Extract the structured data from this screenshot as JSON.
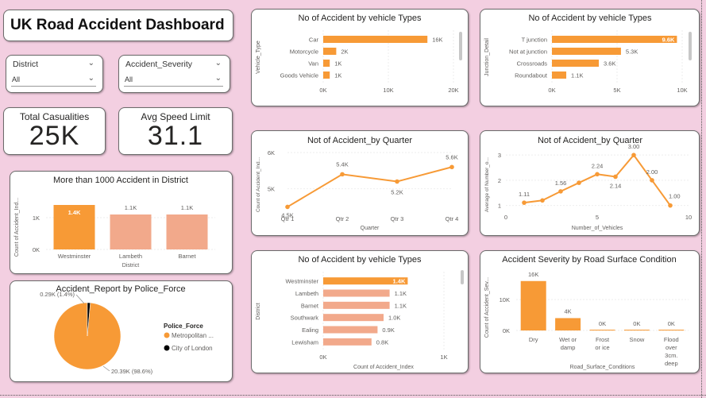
{
  "header": {
    "title": "UK Road Accident Dashboard"
  },
  "slicers": [
    {
      "label": "District",
      "value": "All"
    },
    {
      "label": "Accident_Severity",
      "value": "All"
    }
  ],
  "kpis": [
    {
      "label": "Total Casualities",
      "value": "25K"
    },
    {
      "label": "Avg Speed Limit",
      "value": "31.1"
    }
  ],
  "colors": {
    "accent": "#f79a36",
    "accent_light": "#f2a98b",
    "card": "#ffffff",
    "background": "#f3cfe1"
  },
  "chart_data": [
    {
      "id": "vehicle",
      "type": "bar",
      "orientation": "horizontal",
      "title": "No of Accident by vehicle Types",
      "ylabel": "Vehicle_Type",
      "categories": [
        "Car",
        "Motorcycle",
        "Van",
        "Goods Vehicle"
      ],
      "values": [
        16000,
        2000,
        1000,
        1000
      ],
      "data_labels": [
        "16K",
        "2K",
        "1K",
        "1K"
      ],
      "xticks": [
        "0K",
        "10K",
        "20K"
      ],
      "xlim": [
        0,
        20000
      ]
    },
    {
      "id": "junction",
      "type": "bar",
      "orientation": "horizontal",
      "title": "No of Accident by vehicle Types",
      "ylabel": "Junction_Detail",
      "categories": [
        "T junction",
        "Not at junction",
        "Crossroads",
        "Roundabout"
      ],
      "values": [
        9600,
        5300,
        3600,
        1100
      ],
      "data_labels": [
        "9.6K",
        "5.3K",
        "3.6K",
        "1.1K"
      ],
      "xticks": [
        "0K",
        "5K",
        "10K"
      ],
      "xlim": [
        0,
        10000
      ]
    },
    {
      "id": "district_bar",
      "type": "bar",
      "orientation": "vertical",
      "title": "More than 1000 Accident in District",
      "xlabel": "District",
      "ylabel": "Count of Accident_Ind...",
      "categories": [
        "Westminster",
        "Lambeth",
        "Barnet"
      ],
      "values": [
        1400,
        1100,
        1100
      ],
      "data_labels": [
        "1.4K",
        "1.1K",
        "1.1K"
      ],
      "yticks": [
        "0K",
        "1K"
      ],
      "ylim": [
        0,
        1700
      ]
    },
    {
      "id": "police_pie",
      "type": "pie",
      "title": "Accident_Report by Police_Force",
      "legend_title": "Police_Force",
      "labels": [
        "Metropolitan ...",
        "City of London"
      ],
      "values": [
        20390,
        290
      ],
      "data_labels": [
        "20.39K (98.6%)",
        "0.29K (1.4%)"
      ],
      "colors": [
        "#f79a36",
        "#000000"
      ]
    },
    {
      "id": "quarter_line",
      "type": "line",
      "title": "Not of Accident_by Quarter",
      "xlabel": "Quarter",
      "ylabel": "Count of Accident_Ind...",
      "categories": [
        "Qtr 1",
        "Qtr 2",
        "Qtr 3",
        "Qtr 4"
      ],
      "values": [
        4500,
        5400,
        5200,
        5600
      ],
      "data_labels": [
        "4.5K",
        "5.4K",
        "5.2K",
        "5.6K"
      ],
      "yticks": [
        "5K",
        "6K"
      ],
      "ylim": [
        4400,
        6000
      ]
    },
    {
      "id": "vehicles_line",
      "type": "line",
      "title": "Not of Accident_by Quarter",
      "xlabel": "Number_of_Vehicles",
      "ylabel": "Average of Number_o...",
      "x": [
        1,
        2,
        3,
        4,
        5,
        6,
        7,
        8,
        9
      ],
      "values": [
        1.11,
        1.2,
        1.56,
        1.9,
        2.24,
        2.14,
        3.0,
        2.0,
        1.0
      ],
      "data_labels": [
        "1.11",
        "",
        "1.56",
        "",
        "2.24",
        "2.14",
        "3.00",
        "2.00",
        "1.00"
      ],
      "xticks": [
        "0",
        "5",
        "10"
      ],
      "yticks": [
        "1",
        "2",
        "3"
      ],
      "xlim": [
        0,
        10
      ],
      "ylim": [
        0.8,
        3.1
      ]
    },
    {
      "id": "district_hbar",
      "type": "bar",
      "orientation": "horizontal",
      "title": "No of Accident by vehicle Types",
      "xlabel": "Count of Accident_Index",
      "ylabel": "District",
      "categories": [
        "Westminster",
        "Lambeth",
        "Barnet",
        "Southwark",
        "Ealing",
        "Lewisham"
      ],
      "values": [
        1400,
        1100,
        1100,
        1000,
        900,
        800
      ],
      "data_labels": [
        "1.4K",
        "1.1K",
        "1.1K",
        "1.0K",
        "0.9K",
        "0.8K"
      ],
      "xticks": [
        "0K",
        "1K"
      ],
      "xlim": [
        0,
        2000
      ]
    },
    {
      "id": "surface",
      "type": "bar",
      "orientation": "vertical",
      "title": "Accident Severity by Road Surface Condition",
      "xlabel": "Road_Surface_Conditions",
      "ylabel": "Count of Accident_Sev...",
      "categories": [
        "Dry",
        "Wet or damp",
        "Frost or ice",
        "Snow",
        "Flood over 3cm. deep"
      ],
      "values": [
        16000,
        4000,
        0,
        0,
        0
      ],
      "data_labels": [
        "16K",
        "4K",
        "0K",
        "0K",
        "0K"
      ],
      "yticks": [
        "0K",
        "10K"
      ],
      "ylim": [
        0,
        18000
      ]
    }
  ]
}
